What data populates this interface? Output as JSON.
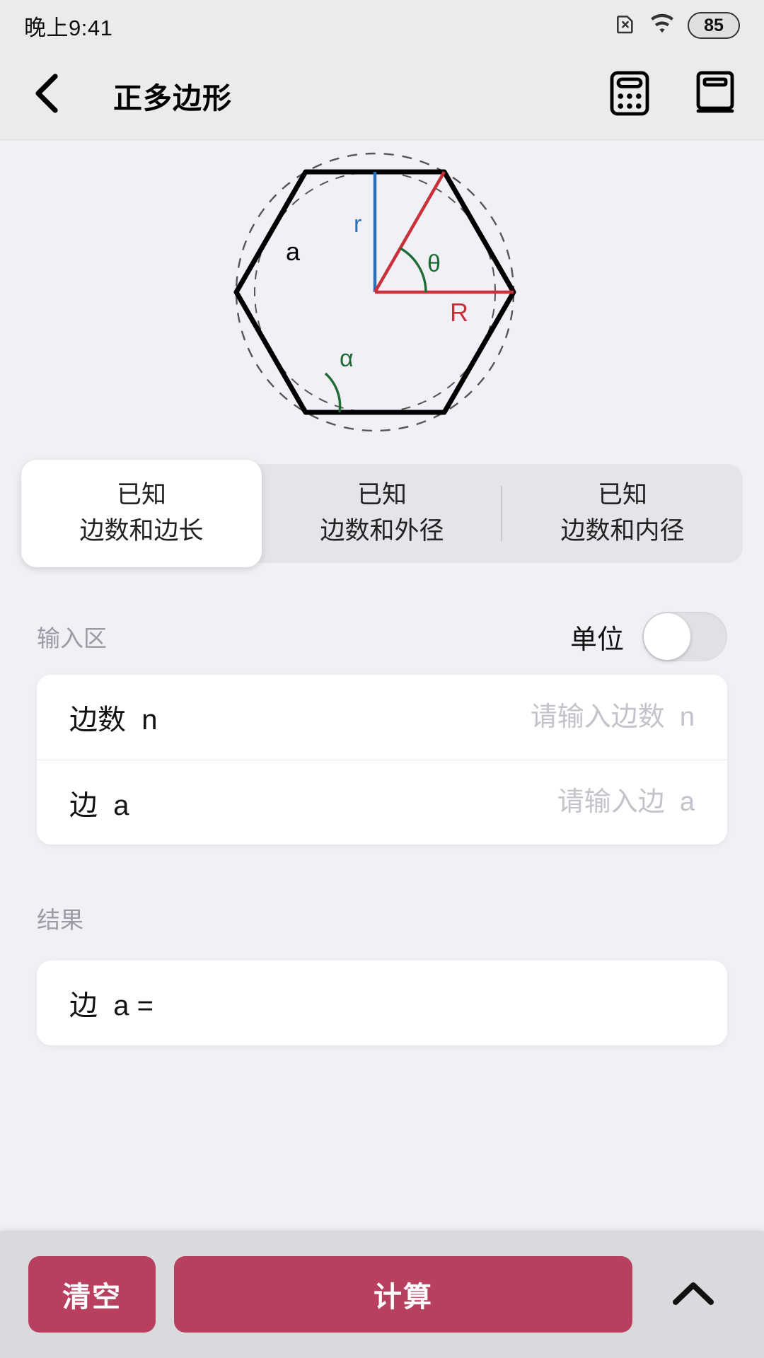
{
  "statusbar": {
    "time": "晚上9:41",
    "sim_icon": "sim-card-off-icon",
    "wifi_icon": "wifi-icon",
    "battery_icon": "battery-icon",
    "battery_level": "85"
  },
  "header": {
    "back_icon": "chevron-left-icon",
    "title": "正多边形",
    "calculator_icon": "calculator-icon",
    "book_icon": "book-icon"
  },
  "diagram": {
    "name": "regular-polygon-diagram",
    "sides": 6,
    "labels": {
      "side": "a",
      "inradius": "r",
      "circumradius": "R",
      "central_angle": "θ",
      "interior_angle": "α"
    },
    "colors": {
      "polygon": "#000000",
      "inradius": "#2f6fb5",
      "circumradius": "#c9313a",
      "angle": "#1e6b35",
      "circles": "#555555",
      "background": "#f1f0f7"
    }
  },
  "tabs": [
    {
      "line1": "已知",
      "line2": "边数和边长",
      "active": true
    },
    {
      "line1": "已知",
      "line2": "边数和外径",
      "active": false
    },
    {
      "line1": "已知",
      "line2": "边数和内径",
      "active": false
    }
  ],
  "input_section": {
    "label": "输入区",
    "unit_label": "单位",
    "unit_toggle_on": false,
    "fields": [
      {
        "label": "边数  n",
        "value": "",
        "placeholder": "请输入边数  n"
      },
      {
        "label": "边  a",
        "value": "",
        "placeholder": "请输入边  a"
      }
    ]
  },
  "result_section": {
    "label": "结果",
    "rows": [
      {
        "label": "边  a =",
        "value": ""
      }
    ]
  },
  "bottombar": {
    "clear_label": "清空",
    "calculate_label": "计算",
    "expand_icon": "chevron-up-icon",
    "accent_color": "#b8405e"
  }
}
